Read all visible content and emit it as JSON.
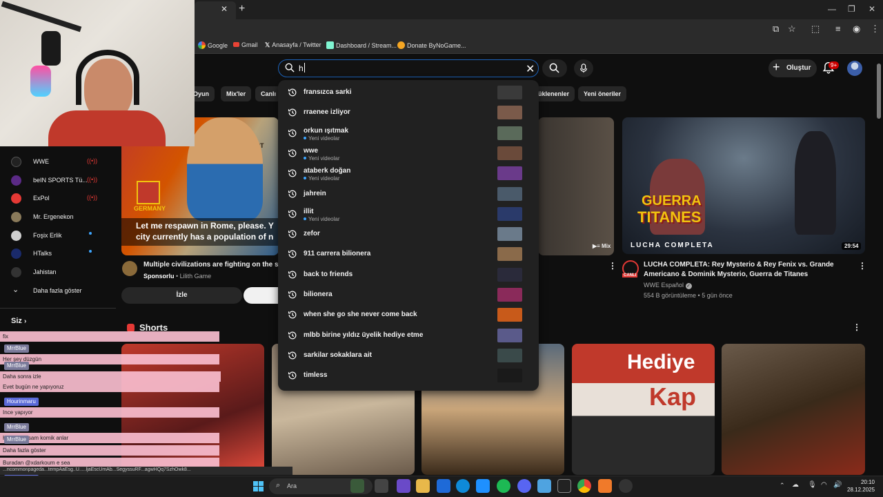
{
  "browser": {
    "bookmarks": [
      "Google",
      "Gmail",
      "Anasayfa / Twitter",
      "Dashboard / Stream...",
      "Donate ByNoGame..."
    ]
  },
  "header": {
    "search_value": "h",
    "create_label": "Oluştur",
    "notification_count": "9+"
  },
  "chips": [
    "Oyun",
    "Mix'ler",
    "Canlı",
    "üklenenler",
    "Yeni öneriler"
  ],
  "sidebar": {
    "items": [
      {
        "label": "WWE",
        "status": "live"
      },
      {
        "label": "beIN SPORTS Tü...",
        "status": "live"
      },
      {
        "label": "ExPol",
        "status": "live"
      },
      {
        "label": "Mr. Ergenekon",
        "status": ""
      },
      {
        "label": "Foşix Erlik",
        "status": "new"
      },
      {
        "label": "HTalks",
        "status": "new"
      },
      {
        "label": "Jahistan",
        "status": ""
      },
      {
        "label": "Daha fazla göster",
        "status": ""
      }
    ],
    "you_label": "Siz"
  },
  "ad_card": {
    "caption_line1": "Let me respawn in Rome, please. Y",
    "caption_line2": "city currently has a population of n",
    "thumb_label": "GERMANY",
    "map_label": "EGYPT",
    "title": "Multiple civilizations are fighting on the s",
    "sponsor": "Sponsorlu",
    "channel": "Lilith Game",
    "watch_label": "İzle"
  },
  "mix_badge": "Mix",
  "video_card": {
    "thumb_title1": "GUERRA",
    "thumb_title2": "TITANES",
    "thumb_subtitle": "LUCHA COMPLETA",
    "duration": "29:54",
    "title": "LUCHA COMPLETA: Rey Mysterio & Rey Fenix vs. Grande Americano & Dominik Mysterio, Guerra de Titanes",
    "channel": "WWE Español",
    "meta": "554 B görüntüleme • 5 gün önce",
    "live_tag": "CANLI"
  },
  "shorts": {
    "title": "Shorts",
    "short4_text1": "Hediye",
    "short4_text2": "Kap"
  },
  "suggestions": [
    {
      "text": "fransızca sarki",
      "sub": "",
      "color": "#3a3a3a"
    },
    {
      "text": "rraenee izliyor",
      "sub": "",
      "color": "#7a5a4a"
    },
    {
      "text": "orkun ışıtmak",
      "sub": "Yeni videolar",
      "color": "#5a6a5a"
    },
    {
      "text": "wwe",
      "sub": "Yeni videolar",
      "color": "#6a4a3a"
    },
    {
      "text": "ataberk doğan",
      "sub": "Yeni videolar",
      "color": "#6a3a8a"
    },
    {
      "text": "jahrein",
      "sub": "",
      "color": "#4a5a6a"
    },
    {
      "text": "illit",
      "sub": "Yeni videolar",
      "color": "#2a3a6a"
    },
    {
      "text": "zefor",
      "sub": "",
      "color": "#6a7a8a"
    },
    {
      "text": "911 carrera bilionera",
      "sub": "",
      "color": "#8a6a4a"
    },
    {
      "text": "back to friends",
      "sub": "",
      "color": "#2a2a3a"
    },
    {
      "text": "bilionera",
      "sub": "",
      "color": "#8a2a5a"
    },
    {
      "text": "when she go she never come back",
      "sub": "",
      "color": "#c85a1a"
    },
    {
      "text": "mlbb birine yıldız üyelik hediye etme",
      "sub": "",
      "color": "#5a5a8a"
    },
    {
      "text": "sarkilar sokaklara ait",
      "sub": "",
      "color": "#3a4a4a"
    },
    {
      "text": "timless",
      "sub": "",
      "color": "#1a1a1a"
    }
  ],
  "chat": [
    {
      "user": "",
      "msg": "fix"
    },
    {
      "user": "MrrBlue",
      "msg": "Her şey düzgün"
    },
    {
      "user": "MrrBlue",
      "msg": "Daha sonra izle"
    },
    {
      "user": "",
      "msg": "Evet bugün ne yapıyoruz"
    },
    {
      "user": "Hourinmaru",
      "msg": "Ince yapıyor"
    },
    {
      "user": "MrrBlue",
      "msg": "Hemen husam komik anlar"
    },
    {
      "user": "MrrBlue",
      "msg": "Daha fazla göster"
    },
    {
      "user": "",
      "msg": "Buradan @xdarkoum e sea"
    },
    {
      "user": "Hourinmaru",
      "msg": "husam komik anlar izliyelim"
    }
  ],
  "status_url": "...ncommonpageda...tempAaEsg..U.....ljaEscUmAb...SegyssuRF...agwHQq7SzhOwk8...",
  "taskbar": {
    "search_label": "Ara",
    "time": "20:10",
    "date": "28.12.2025"
  },
  "colors": {
    "accent": "#3ea6ff",
    "live_red": "#e53935",
    "chat_pink": "#f9bdce",
    "search_border": "#1c62b9"
  }
}
